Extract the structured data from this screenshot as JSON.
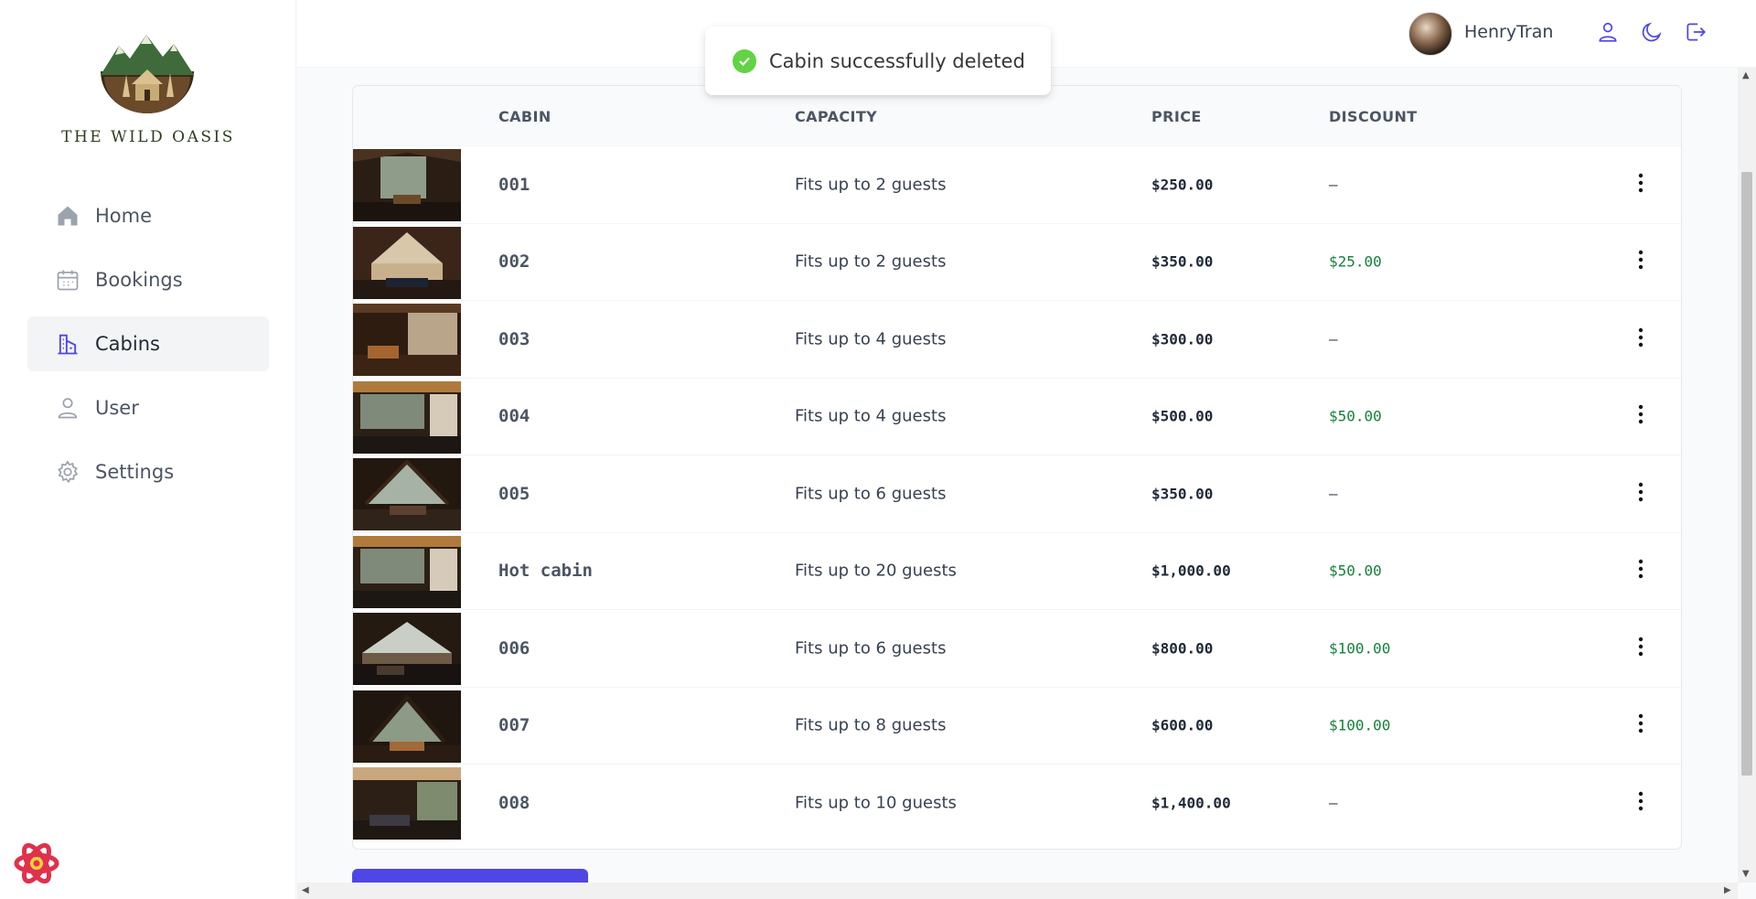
{
  "app": {
    "brand": "THE WILD OASIS"
  },
  "sidebar": {
    "items": [
      {
        "label": "Home",
        "icon": "home-icon"
      },
      {
        "label": "Bookings",
        "icon": "calendar-icon"
      },
      {
        "label": "Cabins",
        "icon": "building-icon",
        "active": true
      },
      {
        "label": "User",
        "icon": "user-icon"
      },
      {
        "label": "Settings",
        "icon": "gear-icon"
      }
    ]
  },
  "header": {
    "username": "HenryTran",
    "icons": [
      "user-icon",
      "moon-icon",
      "logout-icon"
    ]
  },
  "toast": {
    "message": "Cabin successfully deleted",
    "status_color": "#61d345"
  },
  "table": {
    "headers": [
      "",
      "CABIN",
      "CAPACITY",
      "PRICE",
      "DISCOUNT"
    ],
    "rows": [
      {
        "name": "001",
        "capacity": "Fits up to 2 guests",
        "price": "$250.00",
        "discount": "—"
      },
      {
        "name": "002",
        "capacity": "Fits up to 2 guests",
        "price": "$350.00",
        "discount": "$25.00"
      },
      {
        "name": "003",
        "capacity": "Fits up to 4 guests",
        "price": "$300.00",
        "discount": "—"
      },
      {
        "name": "004",
        "capacity": "Fits up to 4 guests",
        "price": "$500.00",
        "discount": "$50.00"
      },
      {
        "name": "005",
        "capacity": "Fits up to 6 guests",
        "price": "$350.00",
        "discount": "—"
      },
      {
        "name": "Hot cabin",
        "capacity": "Fits up to 20 guests",
        "price": "$1,000.00",
        "discount": "$50.00"
      },
      {
        "name": "006",
        "capacity": "Fits up to 6 guests",
        "price": "$800.00",
        "discount": "$100.00"
      },
      {
        "name": "007",
        "capacity": "Fits up to 8 guests",
        "price": "$600.00",
        "discount": "$100.00"
      },
      {
        "name": "008",
        "capacity": "Fits up to 10 guests",
        "price": "$1,400.00",
        "discount": "—"
      }
    ]
  },
  "colors": {
    "accent": "#4f46e5",
    "discount": "#15803d"
  }
}
